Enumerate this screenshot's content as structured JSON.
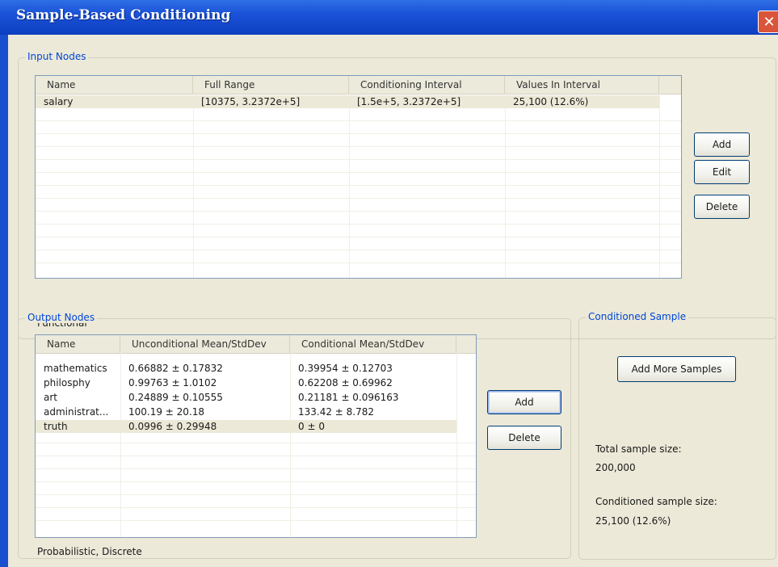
{
  "window": {
    "title": "Sample-Based Conditioning",
    "close_glyph": "✕"
  },
  "input_nodes": {
    "group_title": "Input Nodes",
    "columns": [
      "Name",
      "Full Range",
      "Conditioning Interval",
      "Values In Interval"
    ],
    "rows": [
      {
        "name": "salary",
        "full_range": "[10375, 3.2372e+5]",
        "interval": "[1.5e+5, 3.2372e+5]",
        "values": "25,100  (12.6%)"
      }
    ],
    "type_label": "Functional",
    "buttons": {
      "add": "Add",
      "edit": "Edit",
      "delete": "Delete"
    }
  },
  "output_nodes": {
    "group_title": "Output Nodes",
    "columns": [
      "Name",
      "Unconditional Mean/StdDev",
      "Conditional Mean/StdDev"
    ],
    "rows": [
      {
        "name": "mathematics",
        "uncond": "0.66882 ± 0.17832",
        "cond": "0.39954 ± 0.12703"
      },
      {
        "name": "philosphy",
        "uncond": "0.99763 ± 1.0102",
        "cond": "0.62208 ± 0.69962"
      },
      {
        "name": "art",
        "uncond": "0.24889 ± 0.10555",
        "cond": "0.21181 ± 0.096163"
      },
      {
        "name": "administrat...",
        "uncond": "100.19 ± 20.18",
        "cond": "133.42 ± 8.782"
      },
      {
        "name": "truth",
        "uncond": "0.0996 ± 0.29948",
        "cond": "0 ± 0"
      }
    ],
    "type_label": "Probabilistic, Discrete",
    "buttons": {
      "add": "Add",
      "delete": "Delete"
    }
  },
  "conditioned_sample": {
    "group_title": "Conditioned Sample",
    "add_more_label": "Add More Samples",
    "total_label": "Total sample size:",
    "total_value": "200,000",
    "conditioned_label": "Conditioned sample size:",
    "conditioned_value": "25,100  (12.6%)"
  }
}
